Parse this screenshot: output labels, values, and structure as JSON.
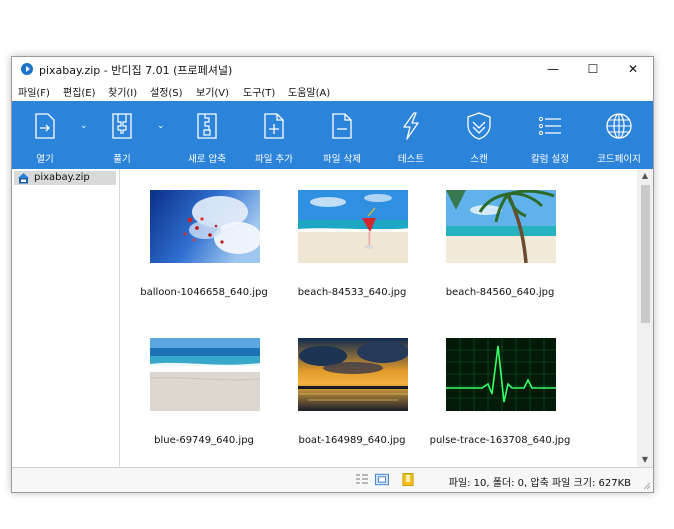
{
  "window": {
    "title": "pixabay.zip - 반디집 7.01 (프로페셔널)",
    "controls": {
      "minimize": "—",
      "maximize": "☐",
      "close": "✕"
    }
  },
  "menu": [
    "파일(F)",
    "편집(E)",
    "찾기(I)",
    "설정(S)",
    "보기(V)",
    "도구(T)",
    "도움말(A)"
  ],
  "toolbar": {
    "open": "열기",
    "extract": "풀기",
    "new_archive": "새로 압축",
    "add_file": "파일 추가",
    "delete_file": "파일 삭제",
    "test": "테스트",
    "scan": "스캔",
    "column_settings": "칼럼 설정",
    "codepage": "코드페이지"
  },
  "tree": {
    "root": "pixabay.zip"
  },
  "files": [
    {
      "name": "balloon-1046658_640.jpg",
      "thumb": "balloon"
    },
    {
      "name": "beach-84533_640.jpg",
      "thumb": "beach-drink"
    },
    {
      "name": "beach-84560_640.jpg",
      "thumb": "beach-palm"
    },
    {
      "name": "blue-69749_640.jpg",
      "thumb": "blue-sea"
    },
    {
      "name": "boat-164989_640.jpg",
      "thumb": "sunset"
    },
    {
      "name": "pulse-trace-163708_640.jpg",
      "thumb": "pulse"
    }
  ],
  "status": {
    "text": "파일: 10, 폴더: 0, 압축 파일 크기: 627KB"
  },
  "colors": {
    "toolbar": "#2b83da",
    "accent": "#1a73c8"
  }
}
